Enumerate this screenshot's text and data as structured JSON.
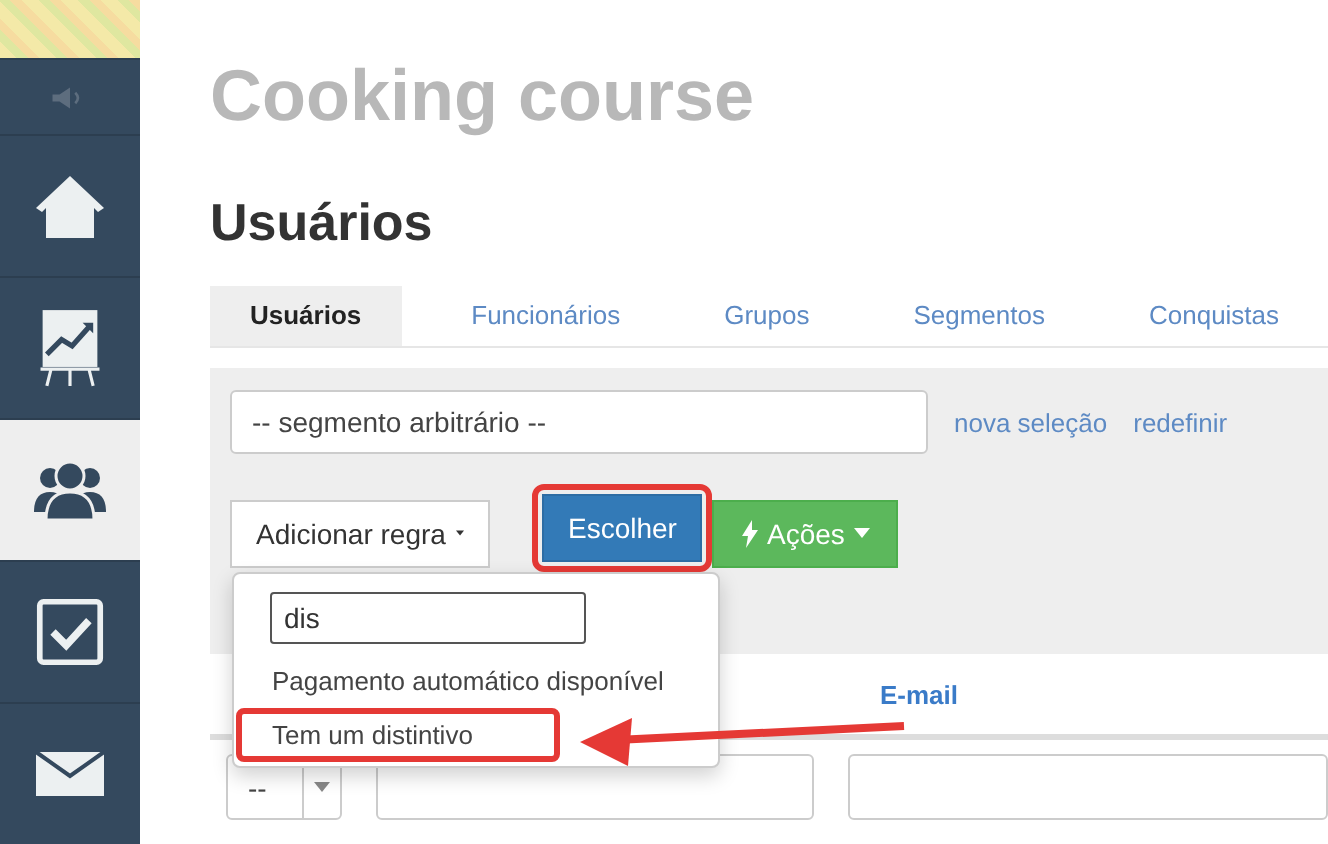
{
  "sidebar": {
    "items": [
      {
        "kind": "speaker",
        "selected": false
      },
      {
        "kind": "home",
        "selected": false
      },
      {
        "kind": "chart",
        "selected": false
      },
      {
        "kind": "users",
        "selected": true
      },
      {
        "kind": "check",
        "selected": false
      },
      {
        "kind": "mail",
        "selected": false
      }
    ]
  },
  "course_title": "Cooking course",
  "page_title": "Usuários",
  "tabs": [
    {
      "label": "Usuários",
      "selected": true
    },
    {
      "label": "Funcionários",
      "selected": false
    },
    {
      "label": "Grupos",
      "selected": false
    },
    {
      "label": "Segmentos",
      "selected": false
    },
    {
      "label": "Conquistas",
      "selected": false
    }
  ],
  "filter": {
    "segment_select": "-- segmento arbitrário --",
    "links": [
      "nova seleção",
      "redefinir"
    ],
    "buttons": [
      {
        "kind": "dropdown",
        "label": "Adicionar regra",
        "highlighted": false
      },
      {
        "kind": "primary",
        "label": "Escolher",
        "highlighted": true
      },
      {
        "kind": "action",
        "label": "Ações",
        "highlighted": false
      }
    ],
    "rule_menu": {
      "search_value": "dis",
      "items": [
        {
          "label": "Pagamento automático disponível",
          "highlighted": false
        },
        {
          "label": "Tem um distintivo",
          "highlighted": true
        }
      ]
    }
  },
  "table": {
    "columns": [
      {
        "label": "E-mail"
      }
    ],
    "filter_row": {
      "select_value": "--"
    }
  }
}
